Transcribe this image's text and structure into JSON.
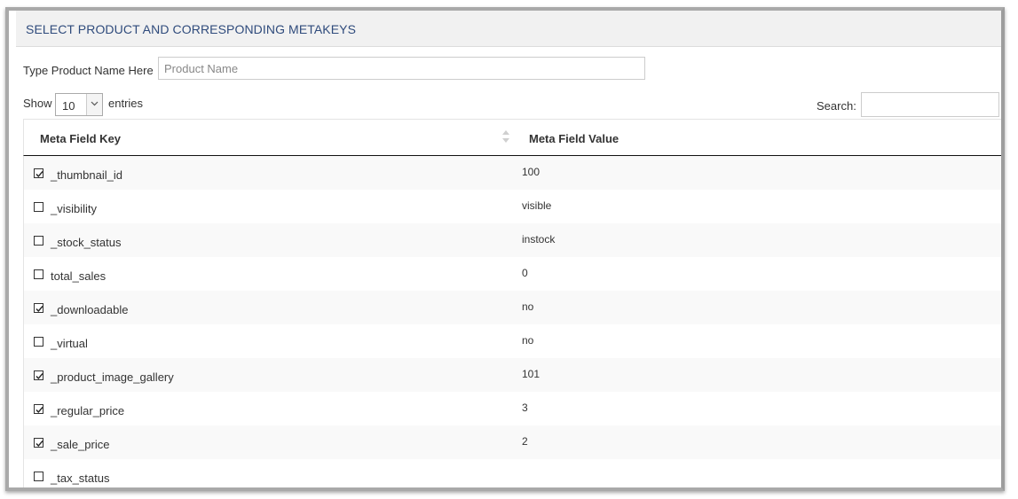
{
  "header": {
    "title": "SELECT PRODUCT AND CORRESPONDING METAKEYS"
  },
  "product": {
    "label": "Type Product Name Here",
    "placeholder": "Product Name",
    "value": ""
  },
  "length": {
    "show_label": "Show",
    "value": "10",
    "entries_label": "entries"
  },
  "search": {
    "label": "Search:",
    "value": ""
  },
  "table": {
    "columns": [
      "Meta Field Key",
      "Meta Field Value"
    ],
    "rows": [
      {
        "checked": true,
        "key": "_thumbnail_id",
        "value": "100"
      },
      {
        "checked": false,
        "key": "_visibility",
        "value": "visible"
      },
      {
        "checked": false,
        "key": "_stock_status",
        "value": "instock"
      },
      {
        "checked": false,
        "key": "total_sales",
        "value": "0"
      },
      {
        "checked": true,
        "key": "_downloadable",
        "value": "no"
      },
      {
        "checked": false,
        "key": "_virtual",
        "value": "no"
      },
      {
        "checked": true,
        "key": "_product_image_gallery",
        "value": "101"
      },
      {
        "checked": true,
        "key": "_regular_price",
        "value": "3"
      },
      {
        "checked": true,
        "key": "_sale_price",
        "value": "2"
      },
      {
        "checked": false,
        "key": "_tax_status",
        "value": ""
      }
    ]
  }
}
